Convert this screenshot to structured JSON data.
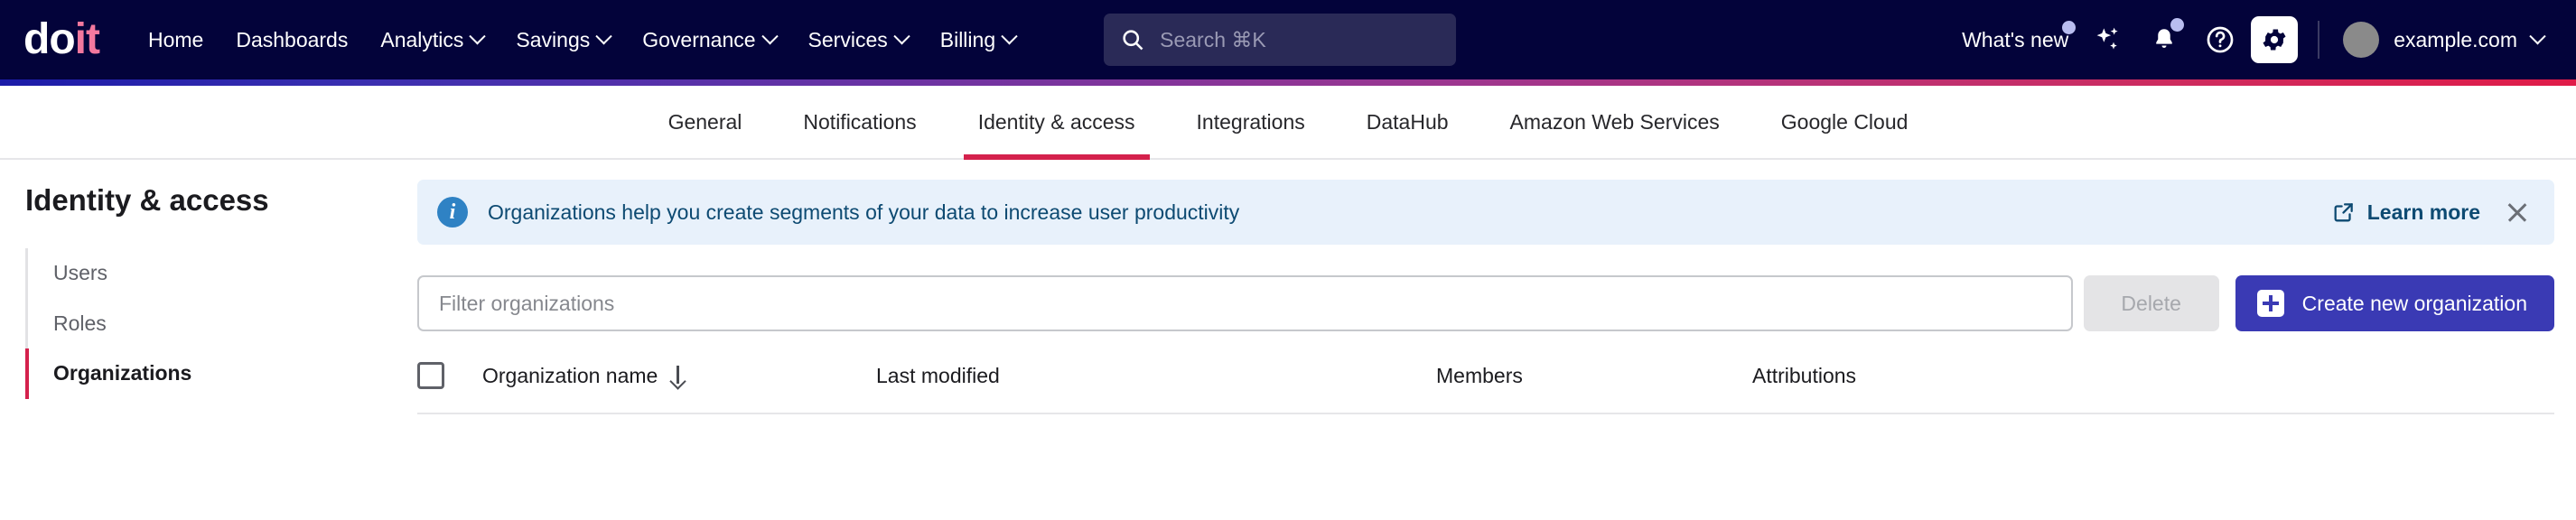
{
  "topbar": {
    "logo": {
      "part1": "do",
      "part2": "it"
    },
    "nav": [
      {
        "label": "Home",
        "has_caret": false
      },
      {
        "label": "Dashboards",
        "has_caret": false
      },
      {
        "label": "Analytics",
        "has_caret": true
      },
      {
        "label": "Savings",
        "has_caret": true
      },
      {
        "label": "Governance",
        "has_caret": true
      },
      {
        "label": "Services",
        "has_caret": true
      },
      {
        "label": "Billing",
        "has_caret": true
      }
    ],
    "search": {
      "placeholder": "Search ⌘K",
      "icon": "search-icon"
    },
    "whats_new": {
      "label": "What's new",
      "has_badge": true
    },
    "icons": [
      {
        "name": "sparkle-icon",
        "badge": false
      },
      {
        "name": "bell-icon",
        "badge": true
      },
      {
        "name": "help-circle-icon",
        "badge": false
      },
      {
        "name": "gear-icon",
        "badge": false,
        "active": true
      }
    ],
    "account": {
      "name": "example.com",
      "avatar": "user-avatar"
    },
    "colors": {
      "background": "#03033a",
      "search_bg": "#2a2a57",
      "logo_pink": "#f3789e"
    }
  },
  "tabs": {
    "items": [
      {
        "label": "General",
        "selected": false
      },
      {
        "label": "Notifications",
        "selected": false
      },
      {
        "label": "Identity & access",
        "selected": true
      },
      {
        "label": "Integrations",
        "selected": false
      },
      {
        "label": "DataHub",
        "selected": false
      },
      {
        "label": "Amazon Web Services",
        "selected": false
      },
      {
        "label": "Google Cloud",
        "selected": false
      }
    ],
    "indicator_color": "#d4214c"
  },
  "sidebar": {
    "title": "Identity & access",
    "items": [
      {
        "label": "Users",
        "active": false
      },
      {
        "label": "Roles",
        "active": false
      },
      {
        "label": "Organizations",
        "active": true
      }
    ],
    "active_color": "#d4214c"
  },
  "banner": {
    "icon": "info-icon",
    "message": "Organizations help you create segments of your data to increase user productivity",
    "learn_more": "Learn more",
    "close": "×",
    "colors": {
      "background": "#e8f1fb",
      "text": "#0d4a72",
      "icon": "#2f82c4"
    }
  },
  "toolbar": {
    "filter_placeholder": "Filter organizations",
    "filter_value": "",
    "delete_label": "Delete",
    "delete_disabled": true,
    "create_label": "Create new organization",
    "create_color": "#3a3ab4"
  },
  "table": {
    "select_all_checked": false,
    "columns": [
      {
        "label": "Organization name",
        "sorted": true,
        "sort_direction": "desc"
      },
      {
        "label": "Last modified",
        "sorted": false
      },
      {
        "label": "Members",
        "sorted": false
      },
      {
        "label": "Attributions",
        "sorted": false
      }
    ],
    "rows": []
  }
}
